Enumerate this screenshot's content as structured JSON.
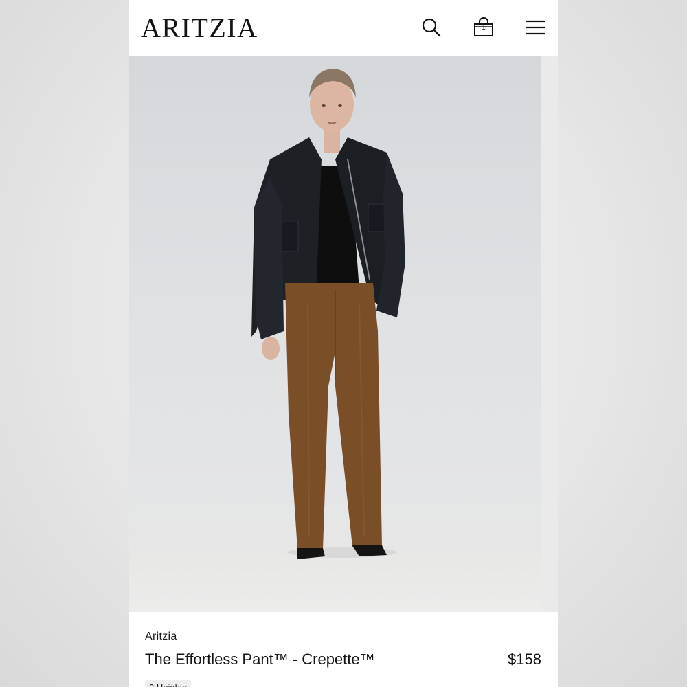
{
  "header": {
    "logo_text": "ARITZIA",
    "bag_count": "1",
    "icons": [
      "search-icon",
      "bag-icon",
      "menu-icon"
    ]
  },
  "product": {
    "brand": "Aritzia",
    "name": "The Effortless Pant™ - Crepette™",
    "price": "$158",
    "chip_label": "2 Heights"
  },
  "colors": {
    "accent": "#141414",
    "background": "#ffffff",
    "pant": "#7a4e27",
    "jacket": "#1b1e22"
  }
}
